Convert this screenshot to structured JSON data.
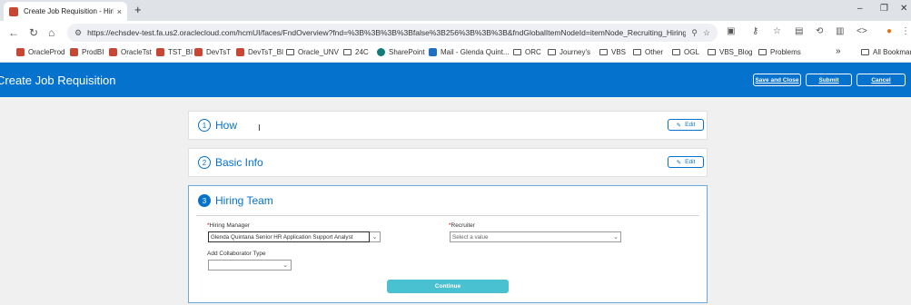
{
  "browser": {
    "tab_title": "Create Job Requisition - Hiring",
    "tab_close": "×",
    "new_tab": "+",
    "url": "https://echsdev-test.fa.us2.oraclecloud.com/hcmUI/faces/FndOverview?fnd=%3B%3B%3B%3Bfalse%3B256%3B%3B%3B&fndGlobalItemNodeId=itemNode_Recruiting_Hiring...",
    "win_minimize": "–",
    "win_restore": "❐",
    "win_close": "✕"
  },
  "bookmarks": [
    {
      "label": "OracleProd",
      "icon": "oracle-icon"
    },
    {
      "label": "ProdBI",
      "icon": "oracle-icon"
    },
    {
      "label": "OracleTst",
      "icon": "oracle-icon"
    },
    {
      "label": "TST_BI",
      "icon": "oracle-icon"
    },
    {
      "label": "DevTsT",
      "icon": "oracle-icon"
    },
    {
      "label": "DevTsT_BI",
      "icon": "oracle-icon"
    },
    {
      "label": "Oracle_UNV",
      "icon": "folder-icon"
    },
    {
      "label": "24C",
      "icon": "folder-icon"
    },
    {
      "label": "SharePoint",
      "icon": "sharepoint-icon"
    },
    {
      "label": "Mail - Glenda Quint...",
      "icon": "mail-icon"
    },
    {
      "label": "ORC",
      "icon": "folder-icon"
    },
    {
      "label": "Journey's",
      "icon": "folder-icon"
    },
    {
      "label": "VBS",
      "icon": "folder-icon"
    },
    {
      "label": "Other",
      "icon": "folder-icon"
    },
    {
      "label": "OGL",
      "icon": "folder-icon"
    },
    {
      "label": "VBS_Blog",
      "icon": "folder-icon"
    },
    {
      "label": "Problems",
      "icon": "folder-icon"
    }
  ],
  "bookmarks_more": "»",
  "bookmarks_all": "All Bookmarks",
  "app": {
    "title": "Create Job Requisition",
    "save_close": "Save and Close",
    "submit": "Submit",
    "cancel": "Cancel"
  },
  "sections": {
    "how": {
      "number": "1",
      "title": "How",
      "edit": "Edit"
    },
    "basic": {
      "number": "2",
      "title": "Basic Info",
      "edit": "Edit"
    },
    "team": {
      "number": "3",
      "title": "Hiring Team"
    }
  },
  "form": {
    "hiring_manager_label": "Hiring Manager",
    "hiring_manager_value": "Glenda Quintana Senior HR Application Support Analyst",
    "recruiter_label": "Recruiter",
    "recruiter_placeholder": "Select a value",
    "collab_label": "Add Collaborator Type",
    "collab_value": "",
    "required_mark": "*",
    "continue": "Continue"
  },
  "colors": {
    "brand_blue": "#0572ce",
    "continue_teal": "#49c1d0"
  }
}
